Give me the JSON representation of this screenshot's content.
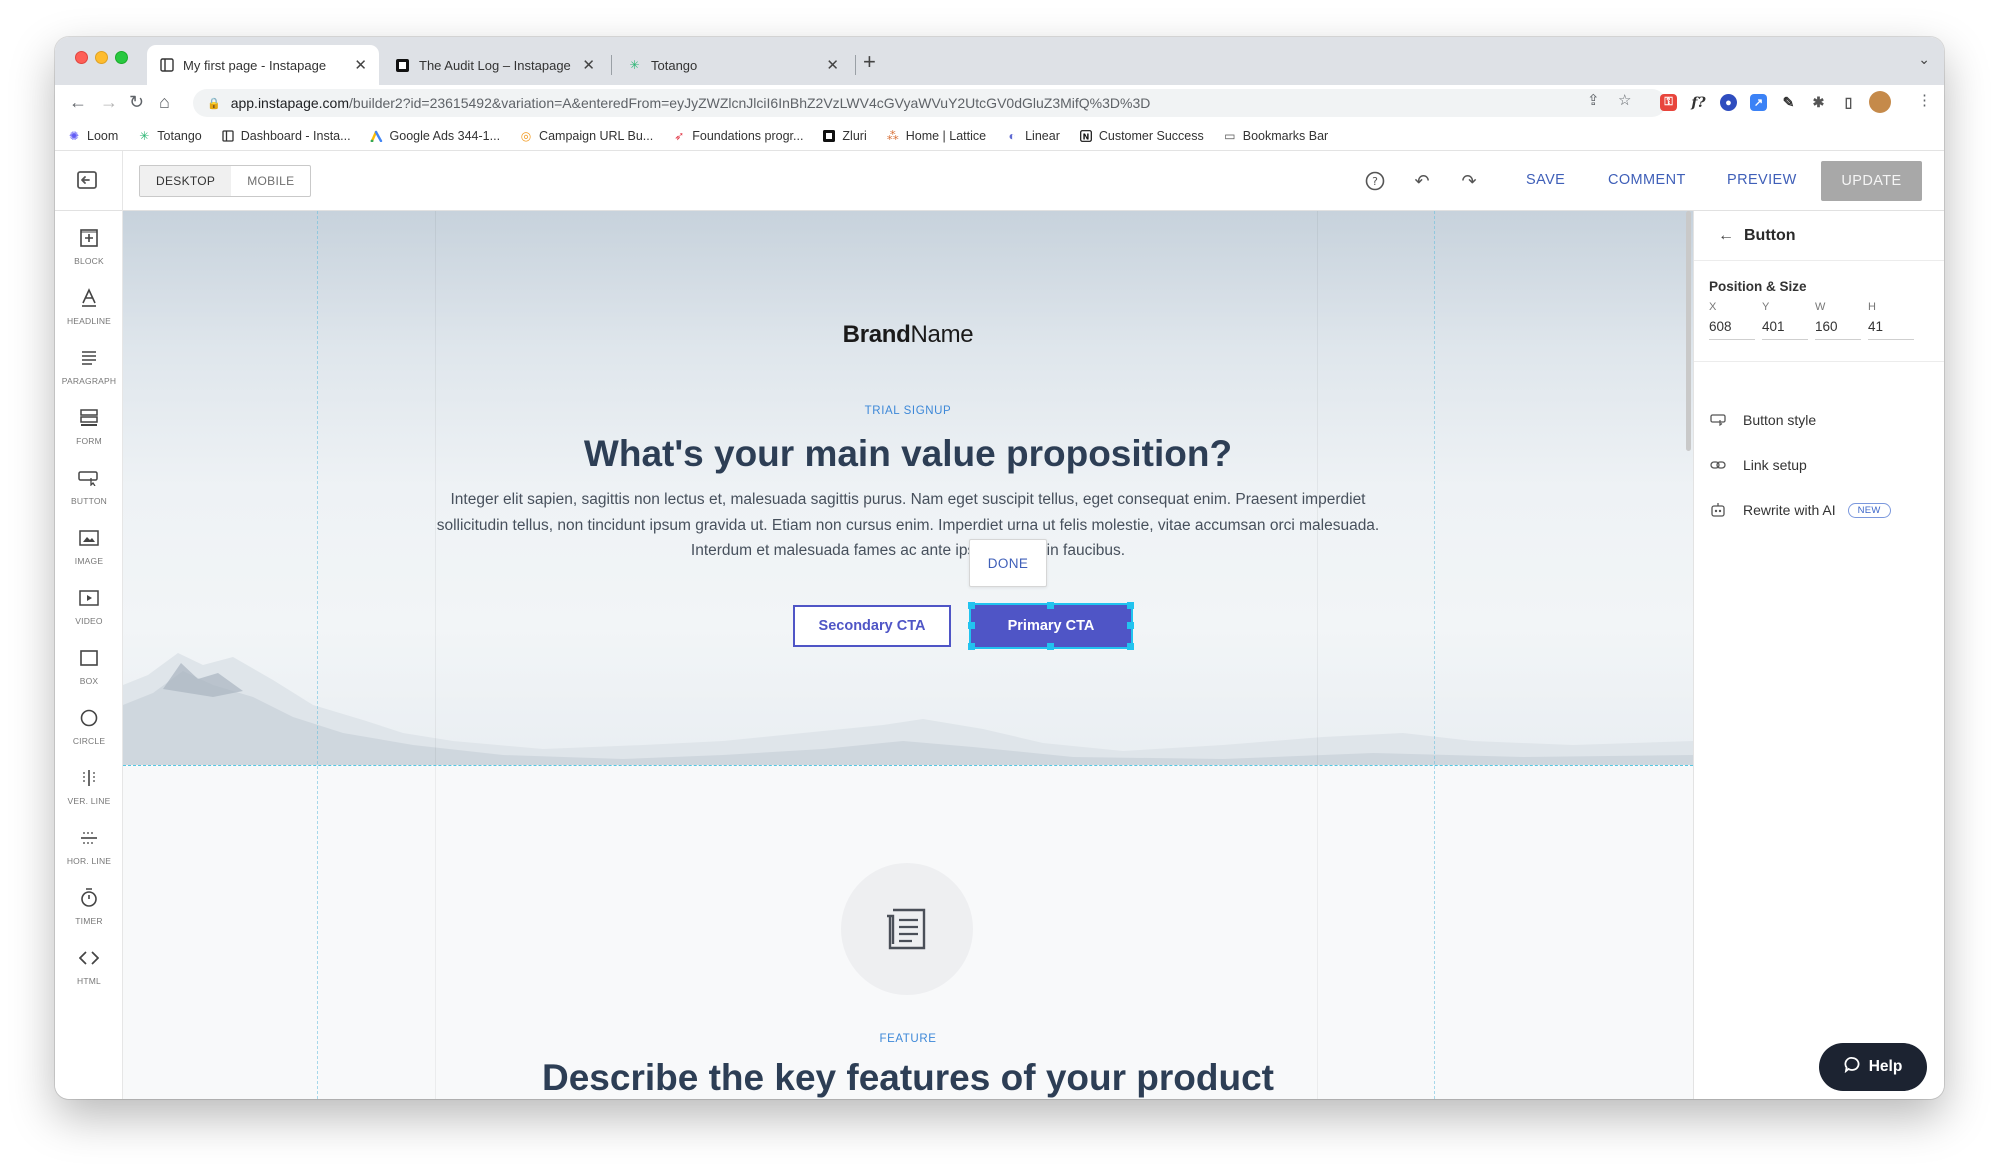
{
  "browser": {
    "tabs": [
      {
        "title": "My first page - Instapage",
        "active": true
      },
      {
        "title": "The Audit Log – Instapage Help",
        "active": false
      },
      {
        "title": "Totango",
        "active": false
      }
    ],
    "url_host": "app.instapage.com",
    "url_rest": "/builder2?id=23615492&variation=A&enteredFrom=eyJyZWZlcnJlciI6InBhZ2VzLWV4cGVyaWVuY2UtcGV0dGluZ3MifQ%3D%3D",
    "bookmarks": [
      "Loom",
      "Totango",
      "Dashboard - Insta...",
      "Google Ads 344-1...",
      "Campaign URL Bu...",
      "Foundations progr...",
      "Zluri",
      "Home | Lattice",
      "Linear",
      "Customer Success",
      "Bookmarks Bar"
    ]
  },
  "header": {
    "device_desktop": "DESKTOP",
    "device_mobile": "MOBILE",
    "save": "SAVE",
    "comment": "COMMENT",
    "preview": "PREVIEW",
    "update": "UPDATE"
  },
  "tools": [
    "BLOCK",
    "HEADLINE",
    "PARAGRAPH",
    "FORM",
    "BUTTON",
    "IMAGE",
    "VIDEO",
    "BOX",
    "CIRCLE",
    "VER. LINE",
    "HOR. LINE",
    "TIMER",
    "HTML"
  ],
  "canvas": {
    "brand_bold": "Brand",
    "brand_regular": "Name",
    "eyebrow": "TRIAL SIGNUP",
    "headline": "What's your main value proposition?",
    "paragraph": "Integer elit sapien, sagittis non lectus et, malesuada sagittis purus. Nam eget suscipit tellus, eget consequat enim. Praesent imperdiet sollicitudin tellus, non tincidunt ipsum gravida ut. Etiam non cursus enim. Imperdiet urna ut felis molestie, vitae accumsan orci malesuada. Interdum et malesuada fames ac ante ipsum primis in faucibus.",
    "done": "DONE",
    "secondary_cta": "Secondary CTA",
    "primary_cta": "Primary CTA",
    "feature_eyebrow": "FEATURE",
    "feature_headline": "Describe the key features of your product"
  },
  "properties": {
    "title": "Button",
    "section_title": "Position & Size",
    "fields": [
      {
        "label": "X",
        "value": "608"
      },
      {
        "label": "Y",
        "value": "401"
      },
      {
        "label": "W",
        "value": "160"
      },
      {
        "label": "H",
        "value": "41"
      }
    ],
    "button_style": "Button style",
    "link_setup": "Link setup",
    "rewrite_ai": "Rewrite with AI",
    "new_badge": "NEW"
  },
  "help": {
    "label": "Help"
  },
  "colors": {
    "primary_cta": "#4f55c6",
    "accent_link": "#3f5fb8",
    "eyebrow": "#3d88d8",
    "selection": "#22c3ef",
    "help_button": "#1c2331"
  },
  "icons": [
    "exit-editor-icon",
    "help-circle-icon",
    "undo-icon",
    "redo-icon",
    "arrow-back-icon",
    "button-style-icon",
    "link-icon",
    "ai-robot-icon",
    "chat-bubble-icon",
    "document-icon"
  ]
}
